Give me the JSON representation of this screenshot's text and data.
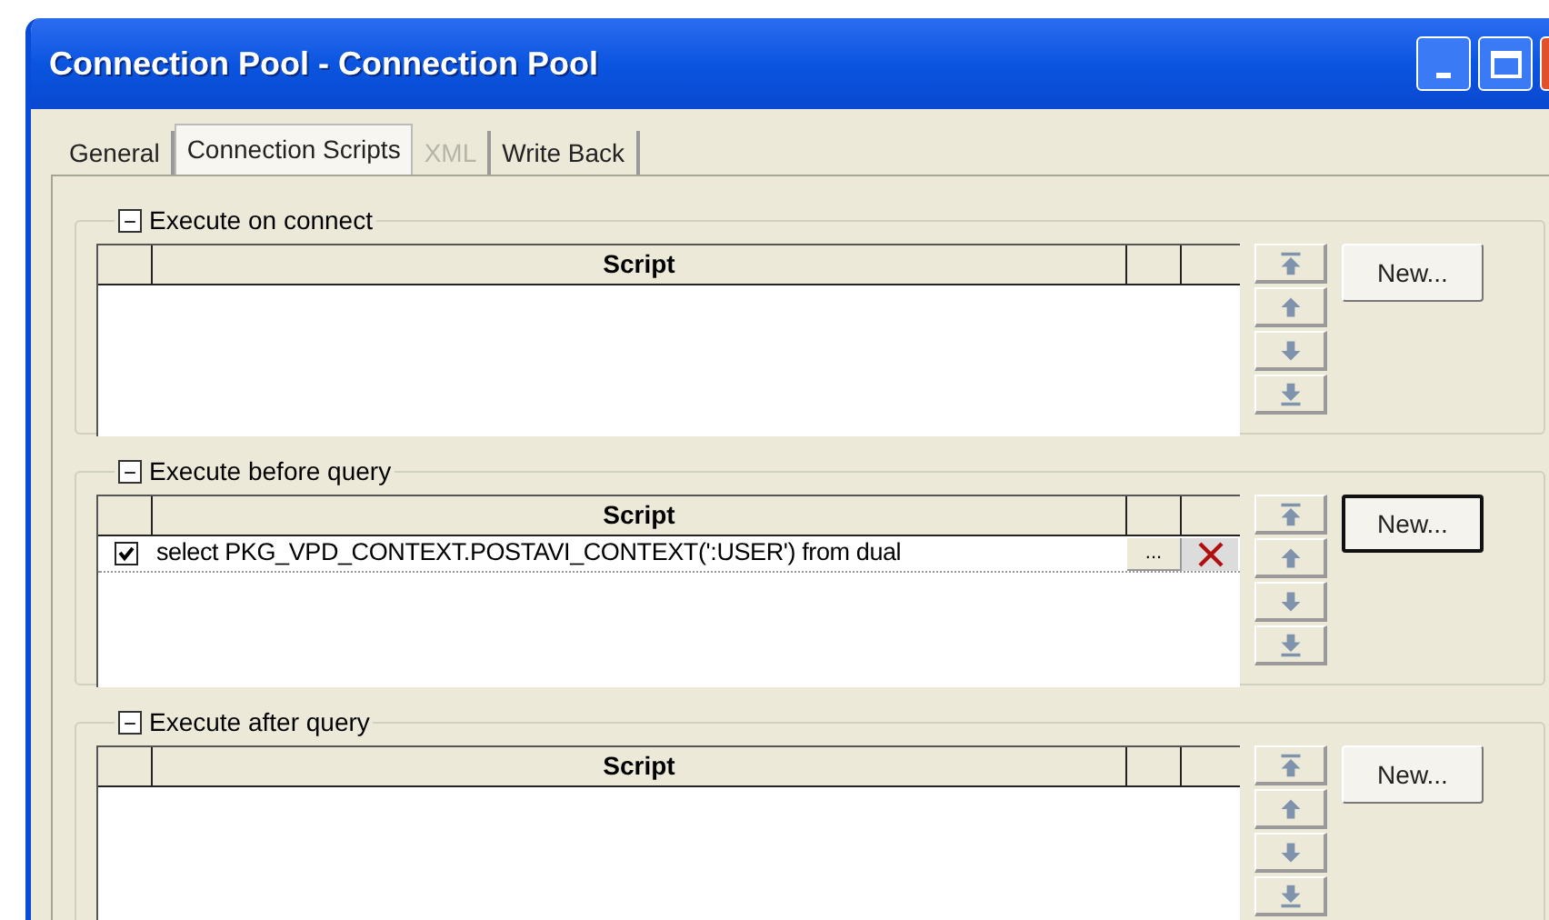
{
  "window": {
    "title": "Connection Pool - Connection Pool"
  },
  "tabs": [
    {
      "label": "General",
      "selected": false,
      "disabled": false
    },
    {
      "label": "Connection Scripts",
      "selected": true,
      "disabled": false
    },
    {
      "label": "XML",
      "selected": false,
      "disabled": true
    },
    {
      "label": "Write Back",
      "selected": false,
      "disabled": false
    }
  ],
  "groups": [
    {
      "title": "Execute on connect",
      "expanded": true,
      "toggle": "−",
      "column": "Script",
      "new_button": {
        "label": "New...",
        "default": false
      }
    },
    {
      "title": "Execute before query",
      "expanded": true,
      "toggle": "−",
      "column": "Script",
      "rows": [
        {
          "checked": true,
          "script": "select PKG_VPD_CONTEXT.POSTAVI_CONTEXT(':USER') from dual",
          "edit_button": "..."
        }
      ],
      "new_button": {
        "label": "New...",
        "default": true
      }
    },
    {
      "title": "Execute after query",
      "expanded": true,
      "toggle": "−",
      "column": "Script",
      "new_button": {
        "label": "New...",
        "default": false
      }
    }
  ]
}
